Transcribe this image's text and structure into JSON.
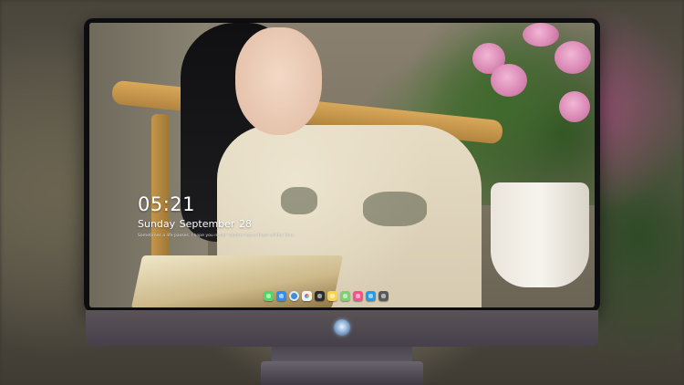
{
  "lock_screen": {
    "time": "05:21",
    "date": "Sunday September  28",
    "quote": "Sometimes a life passes. I hope you never want to leave them all the time"
  },
  "dock": {
    "apps": [
      {
        "name": "messages-icon",
        "color": "#4cd964"
      },
      {
        "name": "finder-icon",
        "color": "#2f8cf0"
      },
      {
        "name": "safari-icon",
        "color": "#3a8fe0"
      },
      {
        "name": "photos-icon",
        "color": "#f2f2f2"
      },
      {
        "name": "video-clapper-icon",
        "color": "#2b2b2b"
      },
      {
        "name": "notes-icon",
        "color": "#f8d54a"
      },
      {
        "name": "maps-icon",
        "color": "#7fcf75"
      },
      {
        "name": "music-icon",
        "color": "#ff4f8b"
      },
      {
        "name": "app-store-icon",
        "color": "#1f9bf0"
      },
      {
        "name": "camera-icon",
        "color": "#58595b"
      }
    ]
  },
  "monitor": {
    "logo_icon": "brand-logo-icon",
    "frame_color": "#0d0d10",
    "chin_color": "#4f4a52"
  }
}
